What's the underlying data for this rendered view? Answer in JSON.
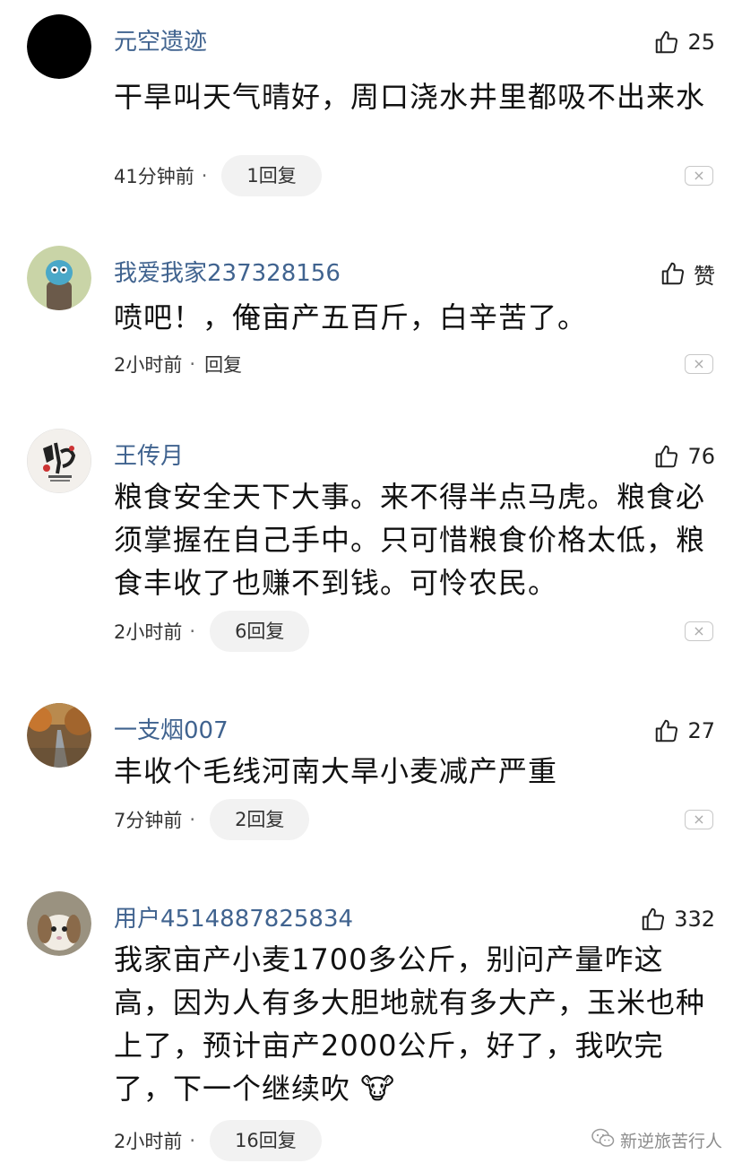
{
  "comments": [
    {
      "username": "元空遗迹",
      "likes": "25",
      "text": "干旱叫天气晴好，周口浇水井里都吸不出来水",
      "time": "41分钟前",
      "reply": "1回复",
      "avatar": "black-circle-avatar"
    },
    {
      "username": "我爱我家237328156",
      "likes": "赞",
      "text": "喷吧！，俺亩产五百斤，白辛苦了。",
      "time": "2小时前",
      "reply": "回复",
      "avatar": "cartoon-avatar"
    },
    {
      "username": "王传月",
      "likes": "76",
      "text": "粮食安全天下大事。来不得半点马虎。粮食必须掌握在自己手中。只可惜粮食价格太低，粮食丰收了也赚不到钱。可怜农民。",
      "time": "2小时前",
      "reply": "6回复",
      "avatar": "calligraphy-avatar"
    },
    {
      "username": "一支烟007",
      "likes": "27",
      "text": "丰收个毛线河南大旱小麦减产严重",
      "time": "7分钟前",
      "reply": "2回复",
      "avatar": "road-landscape-avatar"
    },
    {
      "username": "用户4514887825834",
      "likes": "332",
      "text": "我家亩产小麦1700多公斤，别问产量咋这高，因为人有多大胆地就有多大产，玉米也种上了，预计亩产2000公斤，好了，我吹完了，下一个继续吹",
      "emoji": "🐮",
      "time": "2小时前",
      "reply": "16回复",
      "avatar": "rabbit-avatar"
    }
  ],
  "meta_separator": "·",
  "close_symbol": "×",
  "watermark": {
    "text": "新逆旅苦行人",
    "icon": "wechat-icon"
  },
  "colors": {
    "username": "#40638f",
    "text": "#111111",
    "meta": "#333333",
    "pill_bg": "#f2f2f2"
  }
}
